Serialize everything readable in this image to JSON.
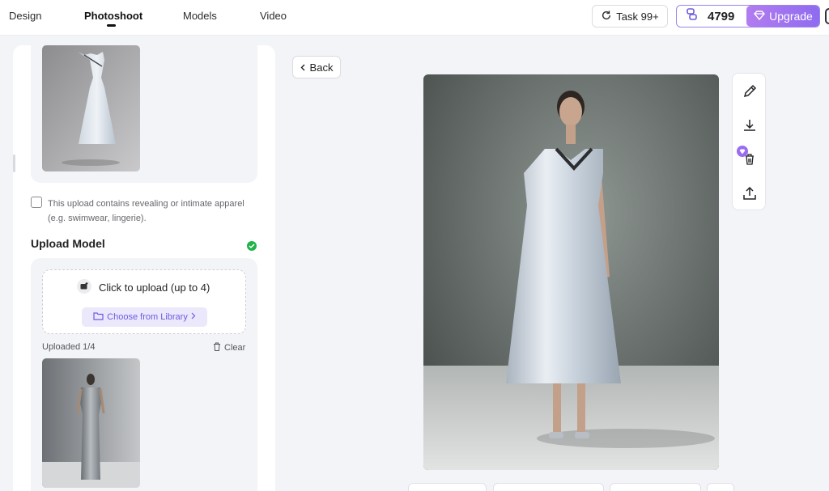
{
  "nav": {
    "tabs": [
      {
        "label": "Design"
      },
      {
        "label": "Photoshoot"
      },
      {
        "label": "Models"
      },
      {
        "label": "Video"
      }
    ],
    "active_tab": "Photoshoot",
    "task_button": "Task 99+",
    "credits": "4799",
    "upgrade_label": "Upgrade"
  },
  "left_panel": {
    "revealing_checkbox_label": "This upload contains revealing or intimate apparel (e.g. swimwear, lingerie).",
    "revealing_checked": false,
    "upload_model_title": "Upload Model",
    "upload_prompt": "Click to upload (up to 4)",
    "library_button": "Choose from Library",
    "uploaded_count": "Uploaded 1/4",
    "clear_label": "Clear"
  },
  "main": {
    "back_label": "Back",
    "toolbar_icons": [
      "pencil-icon",
      "download-icon",
      "trash-icon",
      "share-icon"
    ]
  },
  "colors": {
    "accent": "#8e6bf0",
    "success": "#1fb34a",
    "library_button_bg": "#ebe8fc"
  }
}
